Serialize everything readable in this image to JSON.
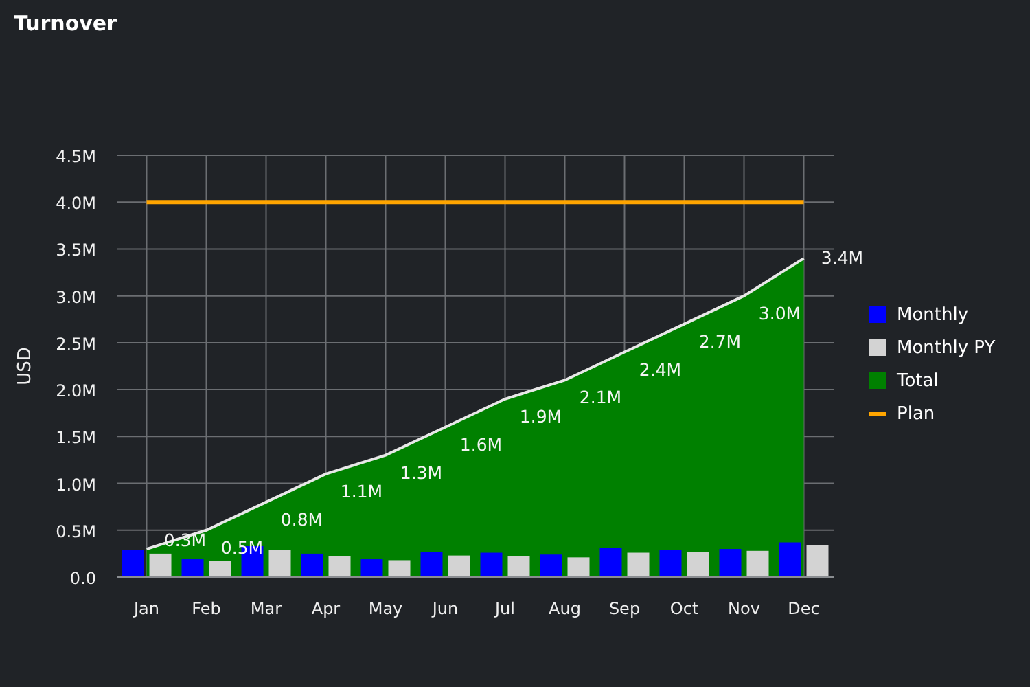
{
  "title": "Turnover",
  "chart": {
    "chart_data": {
      "type": "bar",
      "ylabel": "USD",
      "categories": [
        "Jan",
        "Feb",
        "Mar",
        "Apr",
        "May",
        "Jun",
        "Jul",
        "Aug",
        "Sep",
        "Oct",
        "Nov",
        "Dec"
      ],
      "ylim": [
        0,
        4.5
      ],
      "grid": true,
      "yticks": [
        {
          "value": 0,
          "label": "0.0"
        },
        {
          "value": 0.5,
          "label": "0.5M"
        },
        {
          "value": 1,
          "label": "1.0M"
        },
        {
          "value": 1.5,
          "label": "1.5M"
        },
        {
          "value": 2,
          "label": "2.0M"
        },
        {
          "value": 2.5,
          "label": "2.5M"
        },
        {
          "value": 3,
          "label": "3.0M"
        },
        {
          "value": 3.5,
          "label": "3.5M"
        },
        {
          "value": 4,
          "label": "4.0M"
        },
        {
          "value": 4.5,
          "label": "4.5M"
        }
      ],
      "series": [
        {
          "name": "Monthly",
          "type": "bar",
          "color": "#0000ff",
          "values": [
            0.29,
            0.19,
            0.33,
            0.25,
            0.19,
            0.27,
            0.26,
            0.24,
            0.31,
            0.29,
            0.3,
            0.37
          ]
        },
        {
          "name": "Monthly PY",
          "type": "bar",
          "color": "#d3d3d3",
          "values": [
            0.25,
            0.17,
            0.29,
            0.22,
            0.18,
            0.23,
            0.22,
            0.21,
            0.26,
            0.27,
            0.28,
            0.34
          ]
        },
        {
          "name": "Total",
          "type": "area",
          "color": "#008000",
          "values": [
            0.3,
            0.5,
            0.8,
            1.1,
            1.3,
            1.6,
            1.9,
            2.1,
            2.4,
            2.7,
            3.0,
            3.4
          ],
          "value_labels": [
            "0.3M",
            "0.5M",
            "0.8M",
            "1.1M",
            "1.3M",
            "1.6M",
            "1.9M",
            "2.1M",
            "2.4M",
            "2.7M",
            "3.0M",
            "3.4M"
          ]
        },
        {
          "name": "Plan",
          "type": "line",
          "color": "#ffa500",
          "values": [
            4,
            4,
            4,
            4,
            4,
            4,
            4,
            4,
            4,
            4,
            4,
            4
          ]
        }
      ]
    }
  }
}
